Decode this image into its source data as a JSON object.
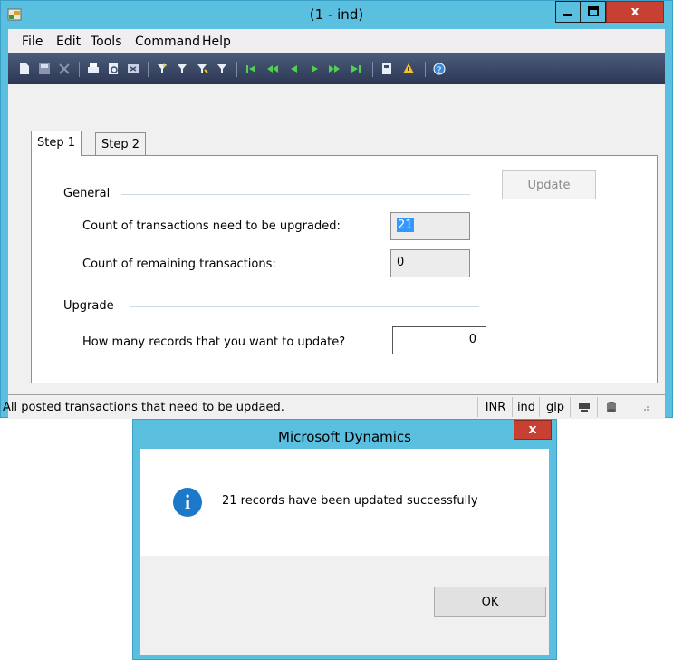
{
  "window": {
    "title": "(1 - ind)",
    "caption_close": "x"
  },
  "menu": [
    "File",
    "Edit",
    "Tools",
    "Command",
    "Help"
  ],
  "toolbar_icons": [
    "new-icon",
    "save-icon",
    "delete-icon",
    "print-icon",
    "print-preview-icon",
    "export-icon",
    "filter-by-selection-icon",
    "filter-by-grid-icon",
    "advanced-filter-icon",
    "sort-filter-icon",
    "first-record-icon",
    "previous-page-icon",
    "previous-record-icon",
    "next-record-icon",
    "next-page-icon",
    "last-record-icon",
    "attach-icon",
    "alert-icon",
    "help-icon"
  ],
  "tabs": [
    "Step 1",
    "Step 2"
  ],
  "form": {
    "update_label": "Update",
    "general_group": "General",
    "count_upgrade_label": "Count of transactions need to be upgraded:",
    "count_upgrade_value": "21",
    "count_remaining_label": "Count of remaining transactions:",
    "count_remaining_value": "0",
    "upgrade_group": "Upgrade",
    "records_label": "How many records that you want to update?",
    "records_value": "0"
  },
  "status": {
    "message": "All posted transactions that need to be updaed.",
    "currency": "INR",
    "company": "ind",
    "layer": "glp"
  },
  "dialog": {
    "title": "Microsoft Dynamics",
    "close": "x",
    "message": "21 records have been updated successfully",
    "ok": "OK"
  },
  "colors": {
    "title_bar": "#5bc0e0",
    "close_button": "#c84031",
    "toolbar": "#2c3754",
    "selection": "#3399ff",
    "info_icon": "#1c79c9"
  }
}
